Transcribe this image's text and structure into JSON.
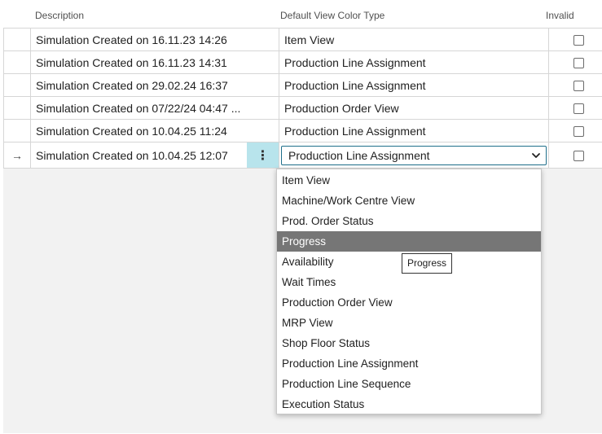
{
  "columns": {
    "description": "Description",
    "color_type": "Default View Color Type",
    "invalid": "Invalid"
  },
  "rows": [
    {
      "description": "Simulation Created on 16.11.23 14:26",
      "color_type": "Item View",
      "invalid": false
    },
    {
      "description": "Simulation Created on 16.11.23 14:31",
      "color_type": "Production Line Assignment",
      "invalid": false
    },
    {
      "description": "Simulation Created on 29.02.24 16:37",
      "color_type": "Production Line Assignment",
      "invalid": false
    },
    {
      "description": "Simulation Created on 07/22/24 04:47 ...",
      "color_type": "Production Order View",
      "invalid": false
    },
    {
      "description": "Simulation Created on 10.04.25 11:24",
      "color_type": "Production Line Assignment",
      "invalid": false
    },
    {
      "description": "Simulation Created on 10.04.25 12:07",
      "color_type": "Production Line Assignment",
      "invalid": false,
      "active": true
    }
  ],
  "row_indicator": "→",
  "row_menu_glyph": "⋮",
  "dropdown": {
    "options": [
      "Item View",
      "Machine/Work Centre View",
      "Prod. Order Status",
      "Progress",
      "Availability",
      "Wait Times",
      "Production Order View",
      "MRP View",
      "Shop Floor Status",
      "Production Line Assignment",
      "Production Line Sequence",
      "Execution Status"
    ],
    "highlighted": "Progress"
  },
  "tooltip": "Progress",
  "colors": {
    "active_cell": "#b8e4ec",
    "highlight": "#767676",
    "select_border": "#1f6f8b"
  }
}
